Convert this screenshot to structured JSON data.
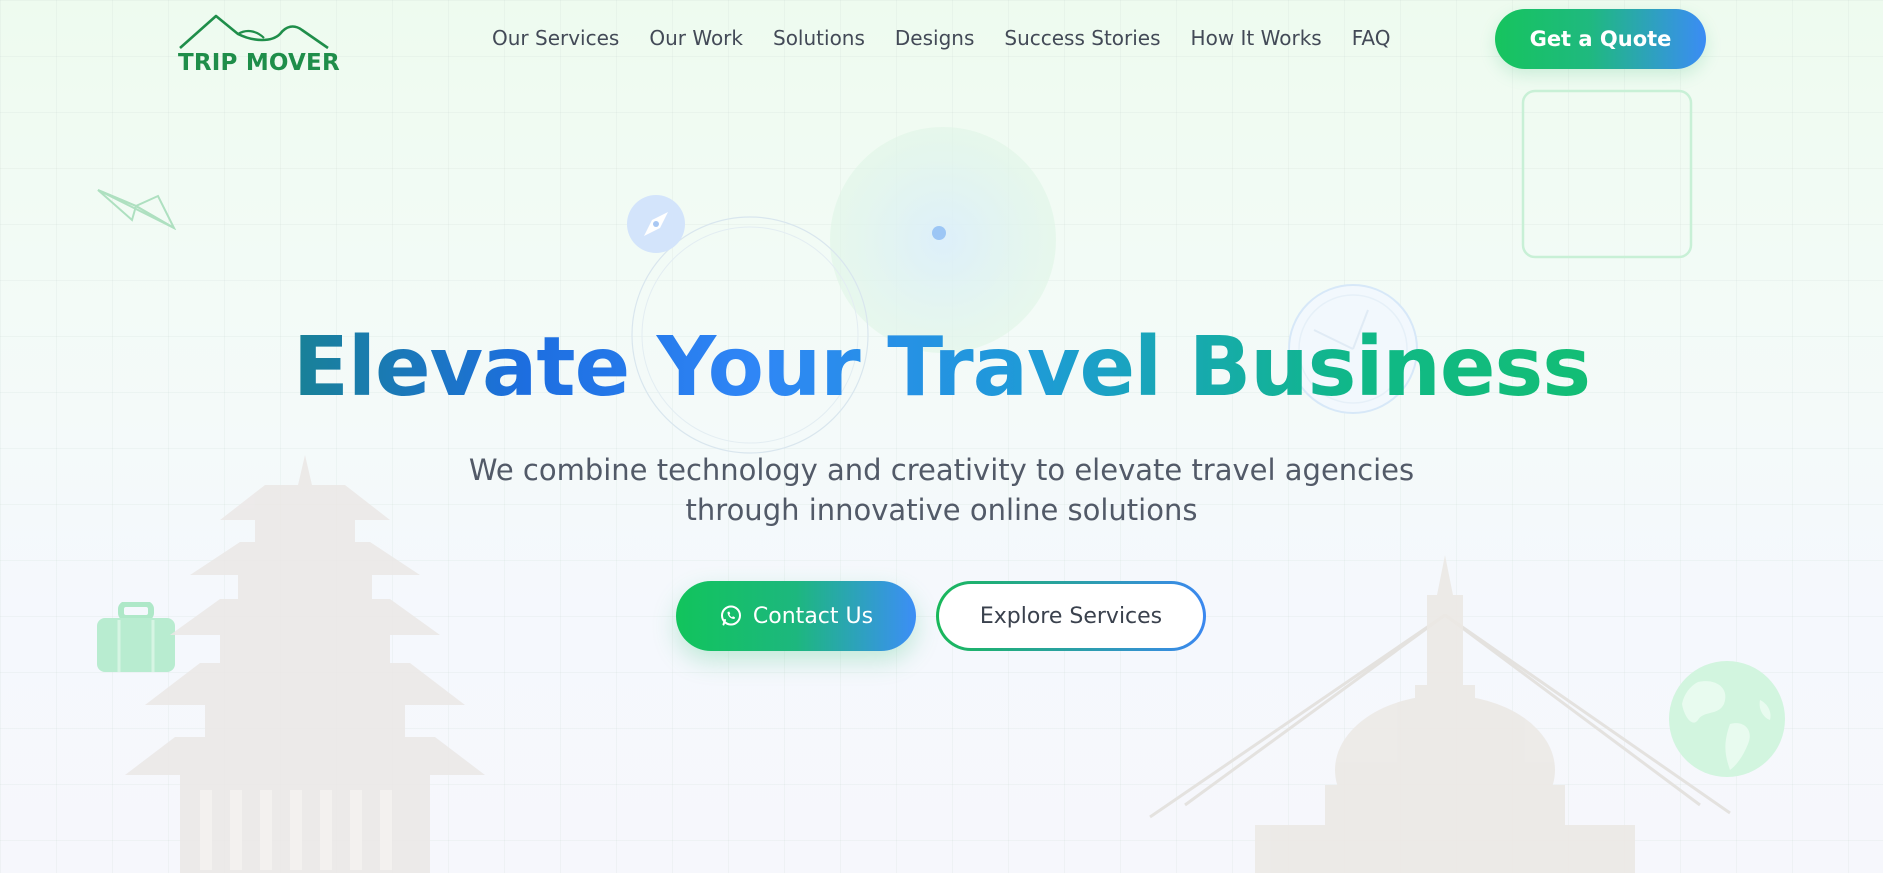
{
  "brand": {
    "name": "TRIP MOVER"
  },
  "nav": {
    "items": [
      {
        "label": "Our Services"
      },
      {
        "label": "Our Work"
      },
      {
        "label": "Solutions"
      },
      {
        "label": "Designs"
      },
      {
        "label": "Success Stories"
      },
      {
        "label": "How It Works"
      },
      {
        "label": "FAQ"
      }
    ],
    "cta_label": "Get a Quote"
  },
  "hero": {
    "title": "Elevate Your Travel Business",
    "subtitle_line1": "We combine technology and creativity to elevate travel agencies",
    "subtitle_line2": "through innovative online solutions",
    "primary_button": "Contact Us",
    "secondary_button": "Explore Services"
  },
  "icons": {
    "paper_plane": "paper-plane-icon",
    "compass": "compass-icon",
    "suitcase": "suitcase-icon",
    "globe": "globe-icon",
    "whatsapp": "whatsapp-icon"
  },
  "colors": {
    "brand_green": "#16c45e",
    "brand_blue": "#3b8cf5",
    "logo_green": "#1f8e4a",
    "text_dark": "#434a57"
  }
}
